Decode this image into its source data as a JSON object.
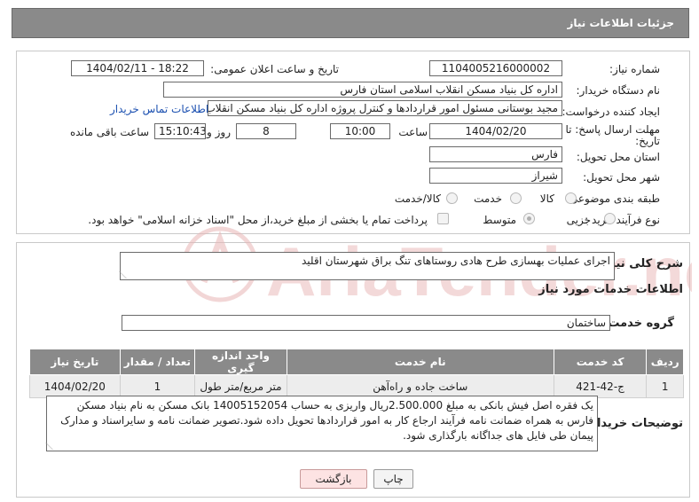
{
  "header": {
    "title": "جزئیات اطلاعات نیاز"
  },
  "form": {
    "need_number_label": "شماره نیاز:",
    "need_number": "1104005216000002",
    "announce_label": "تاریخ و ساعت اعلان عمومی:",
    "announce_value": "1404/02/11 - 18:22",
    "buyer_org_label": "نام دستگاه خریدار:",
    "buyer_org": "اداره کل بنیاد مسکن انقلاب اسلامی استان فارس",
    "creator_label": "ایجاد کننده درخواست:",
    "creator": "مجید بوستانی مسئول امور قراردادها و کنترل پروژه اداره کل بنیاد مسکن انقلاب ا",
    "contact_link": "اطلاعات تماس خریدار",
    "deadline_label_1": "مهلت ارسال پاسخ: تا",
    "deadline_label_2": "تاریخ:",
    "deadline_date": "1404/02/20",
    "time_label": "ساعت",
    "deadline_time": "10:00",
    "days_value": "8",
    "days_label": "روز و",
    "remaining_time": "15:10:43",
    "remaining_label": "ساعت باقی مانده",
    "province_label": "استان محل تحویل:",
    "province": "فارس",
    "city_label": "شهر محل تحویل:",
    "city": "شیراز",
    "category_label": "طبقه بندی موضوعی:",
    "category_options": [
      "کالا",
      "خدمت",
      "کالا/خدمت"
    ],
    "process_label": "نوع فرآیند خرید :",
    "process_options": [
      "جزیی",
      "متوسط"
    ],
    "payment_note": "پرداخت تمام یا بخشی از مبلغ خرید،از محل \"اسناد خزانه اسلامی\" خواهد بود."
  },
  "description": {
    "label": "شرح کلی نیاز:",
    "text": "اجرای عملیات بهسازی طرح هادی روستاهای تنگ براق شهرستان اقلید"
  },
  "services": {
    "section_title": "اطلاعات خدمات مورد نیاز",
    "group_label": "گروه خدمت:",
    "group_value": "ساختمان",
    "columns": [
      "ردیف",
      "کد خدمت",
      "نام خدمت",
      "واحد اندازه گیری",
      "تعداد / مقدار",
      "تاریخ نیاز"
    ],
    "rows": [
      [
        "1",
        "ج-42-421",
        "ساخت جاده و راه‌آهن",
        "متر مربع/متر طول",
        "1",
        "1404/02/20"
      ]
    ]
  },
  "buyer_notes": {
    "label": "توضیحات خریدار:",
    "text": "یک فقره اصل فیش بانکی به مبلغ 2.500.000ریال واریزی به حساب 14005152054 بانک مسکن به نام بنیاد مسکن فارس به همراه ضمانت نامه فرآیند ارجاع کار به امور قراردادها تحویل داده شود.تصویر ضمانت نامه و سایراسناد و مدارک پیمان طی فایل های جداگانه بارگذاری شود."
  },
  "buttons": {
    "print": "چاپ",
    "back": "بازگشت"
  },
  "watermark": {
    "text": "AriaTender.neT"
  },
  "colors": {
    "header": "#8a8a8a",
    "link": "#1a4fb0",
    "watermark": "#e8b4b4"
  }
}
